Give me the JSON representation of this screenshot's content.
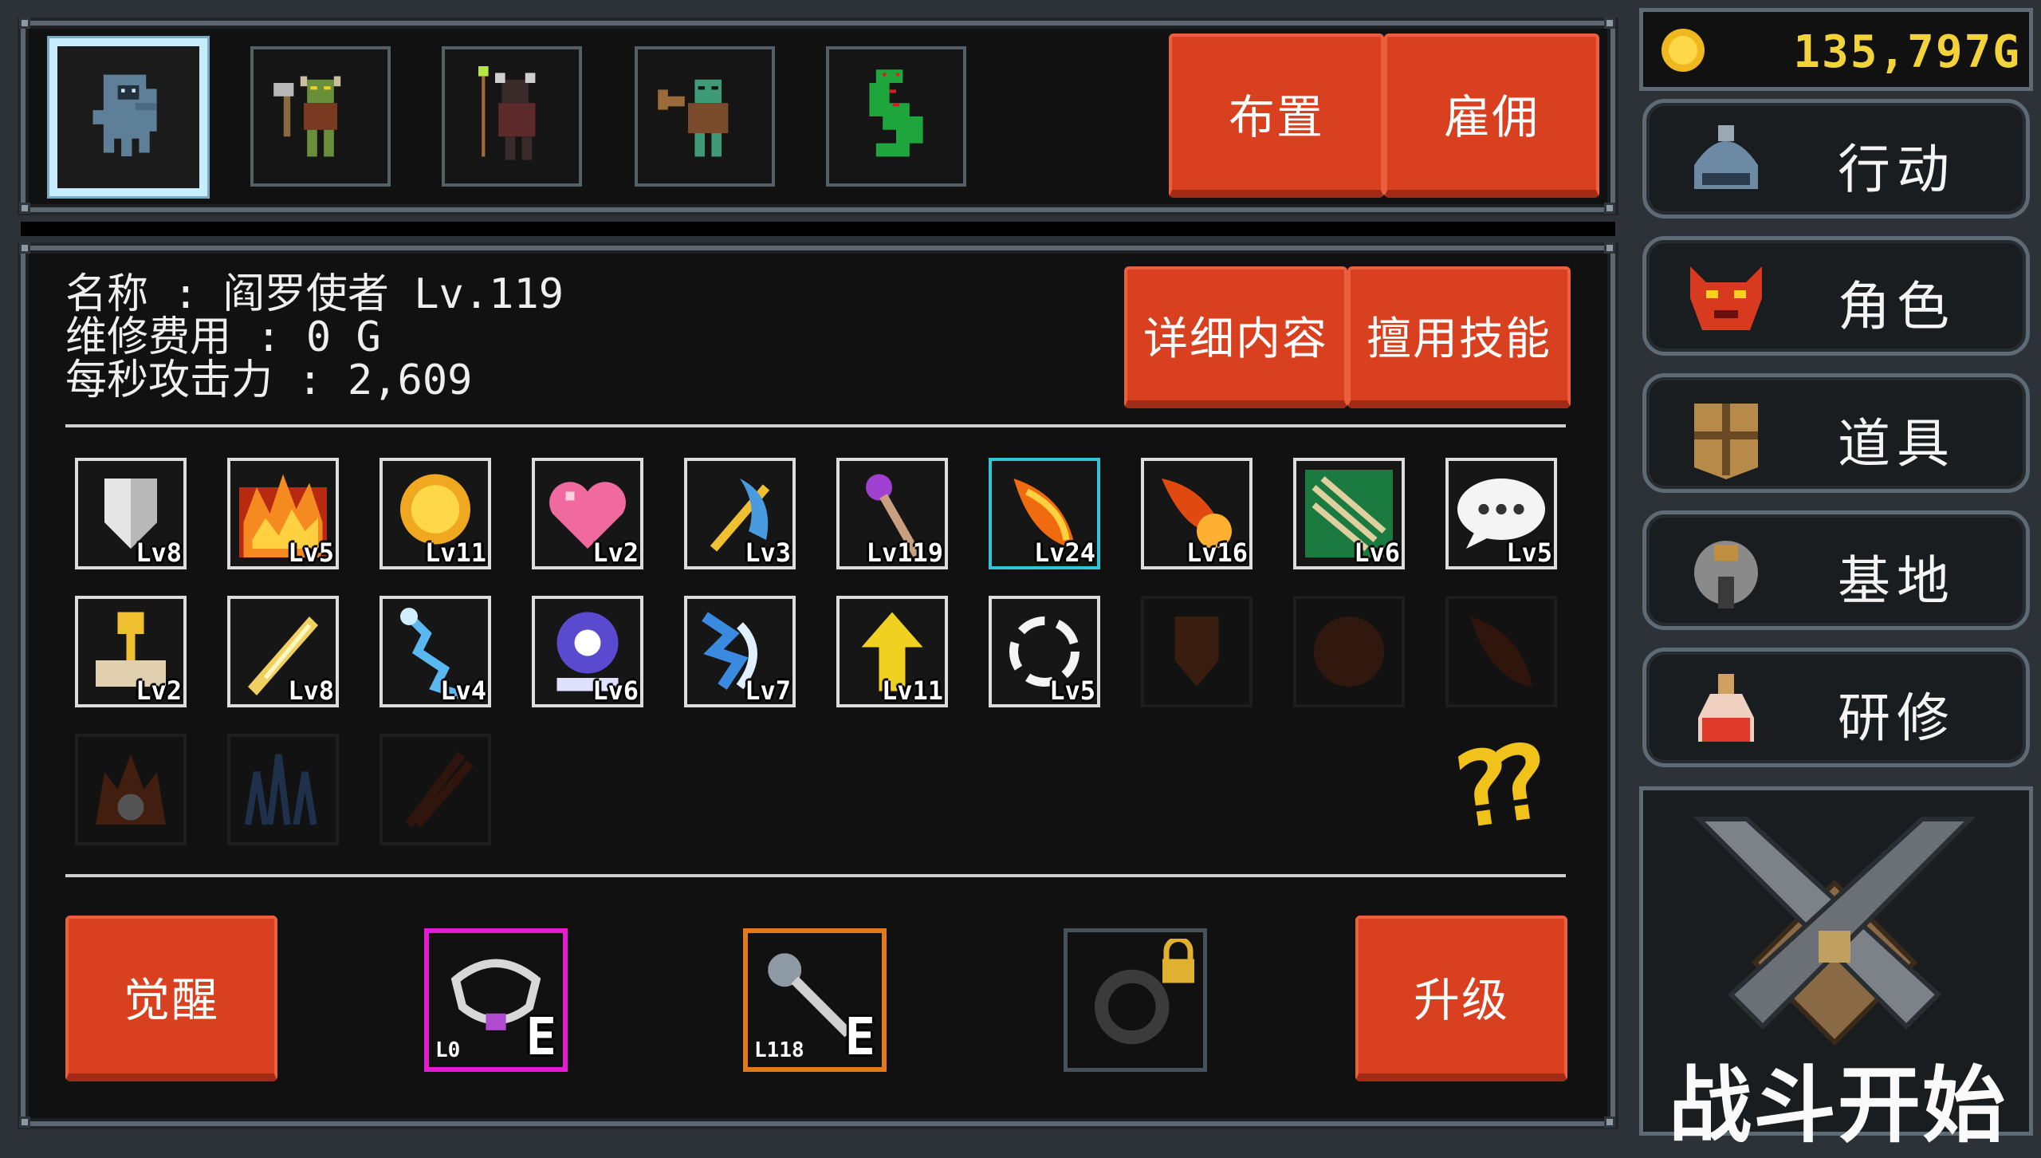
{
  "party": {
    "members": [
      {
        "name": "reaper-ghost-icon",
        "selected": true
      },
      {
        "name": "goblin-axe-icon",
        "selected": false
      },
      {
        "name": "shaman-staff-icon",
        "selected": false
      },
      {
        "name": "orc-club-icon",
        "selected": false
      },
      {
        "name": "green-serpent-icon",
        "selected": false
      }
    ],
    "arrange_label": "布置",
    "hire_label": "雇佣"
  },
  "gold": {
    "amount": "135,797G",
    "color": "#f2d43a"
  },
  "character": {
    "name_line": "名称 : 阎罗使者 Lv.119",
    "upkeep_line": "维修费用 : 0 G",
    "dps_line": "每秒攻击力 : 2,609",
    "details_label": "详细内容",
    "skill_use_label": "擅用技能"
  },
  "skills": [
    {
      "icon": "shield-icon",
      "level": "Lv8",
      "state": "normal"
    },
    {
      "icon": "fire-field-icon",
      "level": "Lv5",
      "state": "normal"
    },
    {
      "icon": "gold-coin-icon",
      "level": "Lv11",
      "state": "normal"
    },
    {
      "icon": "heart-icon",
      "level": "Lv2",
      "state": "normal"
    },
    {
      "icon": "sword-strike-icon",
      "level": "Lv3",
      "state": "normal"
    },
    {
      "icon": "magic-staff-icon",
      "level": "Lv119",
      "state": "normal"
    },
    {
      "icon": "fire-feather-icon",
      "level": "Lv24",
      "state": "selected"
    },
    {
      "icon": "fireball-icon",
      "level": "Lv16",
      "state": "normal"
    },
    {
      "icon": "arrows-icon",
      "level": "Lv6",
      "state": "normal"
    },
    {
      "icon": "speech-bubble-icon",
      "level": "Lv5",
      "state": "normal"
    },
    {
      "icon": "golden-chalice-icon",
      "level": "Lv2",
      "state": "normal"
    },
    {
      "icon": "golden-blade-icon",
      "level": "Lv8",
      "state": "normal"
    },
    {
      "icon": "lightning-icon",
      "level": "Lv4",
      "state": "normal"
    },
    {
      "icon": "eye-crystal-icon",
      "level": "Lv6",
      "state": "normal"
    },
    {
      "icon": "frost-shield-icon",
      "level": "Lv7",
      "state": "normal"
    },
    {
      "icon": "arrow-up-icon",
      "level": "Lv11",
      "state": "normal"
    },
    {
      "icon": "ring-icon",
      "level": "Lv5",
      "state": "normal"
    },
    {
      "icon": "dark-mask-icon",
      "level": "",
      "state": "locked"
    },
    {
      "icon": "dark-orb-icon",
      "level": "",
      "state": "locked"
    },
    {
      "icon": "dark-feather-icon",
      "level": "",
      "state": "locked"
    },
    {
      "icon": "flame-skull-icon",
      "level": "",
      "state": "locked"
    },
    {
      "icon": "ice-spikes-icon",
      "level": "",
      "state": "locked"
    },
    {
      "icon": "shadow-slash-icon",
      "level": "",
      "state": "locked"
    }
  ],
  "hidden_skills_glyph": "??",
  "bottom": {
    "awaken_label": "觉醒",
    "upgrade_label": "升级",
    "equipment": [
      {
        "icon": "necklace-icon",
        "level": "L0",
        "tag": "E",
        "rarity_color": "#e51bd1"
      },
      {
        "icon": "scepter-icon",
        "level": "L118",
        "tag": "E",
        "rarity_color": "#e07a1a"
      },
      {
        "icon": "locked-ring-icon",
        "level": "",
        "tag": "",
        "rarity_color": "#46525a"
      }
    ]
  },
  "sidebar": {
    "items": [
      {
        "icon": "helmet-icon",
        "label": "行动"
      },
      {
        "icon": "demon-mask-icon",
        "label": "角色"
      },
      {
        "icon": "treasure-chest-icon",
        "label": "道具"
      },
      {
        "icon": "fortress-icon",
        "label": "基地"
      },
      {
        "icon": "potion-icon",
        "label": "研修"
      }
    ],
    "battle_label": "战斗开始"
  }
}
